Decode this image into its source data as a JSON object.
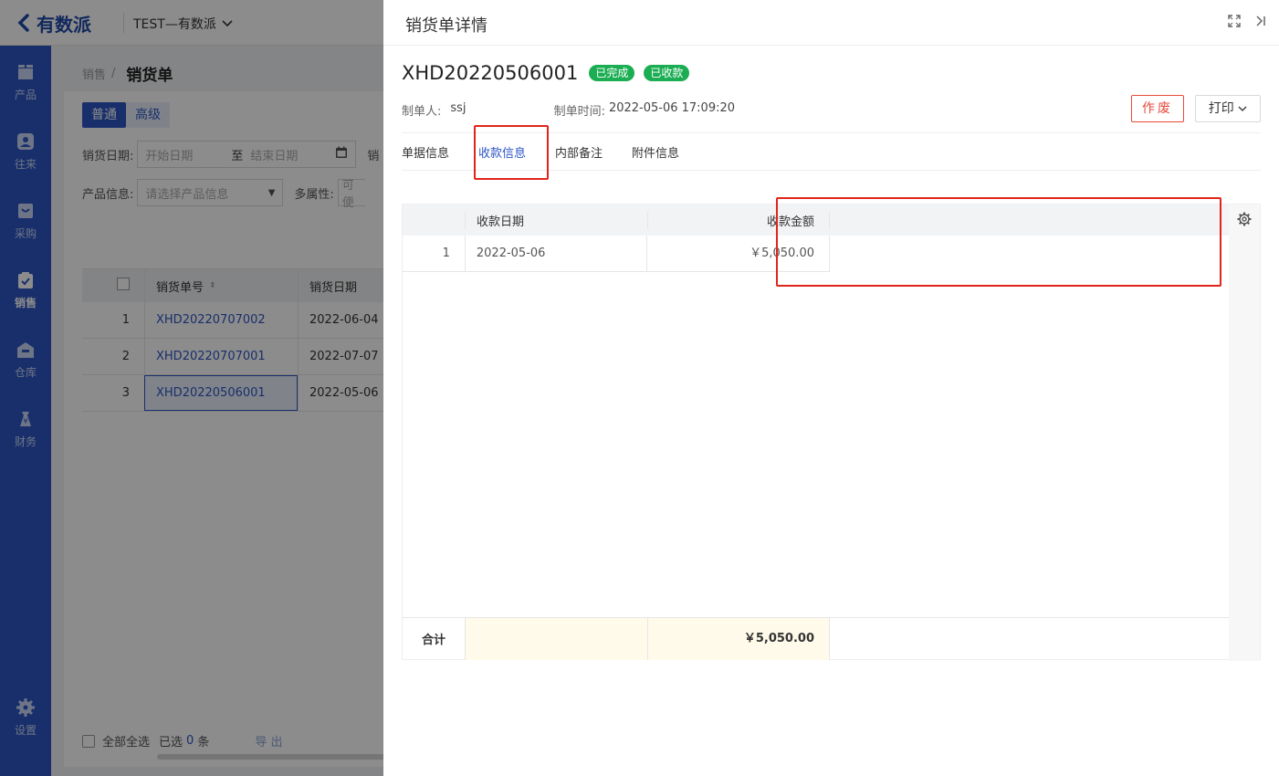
{
  "app": {
    "logo_text": "有数派",
    "company": "TEST—有数派"
  },
  "sidebar": {
    "items": [
      {
        "label": "产品",
        "icon": "box-icon"
      },
      {
        "label": "往来",
        "icon": "contact-icon"
      },
      {
        "label": "采购",
        "icon": "purchase-icon"
      },
      {
        "label": "销售",
        "icon": "sales-icon",
        "active": true
      },
      {
        "label": "仓库",
        "icon": "warehouse-icon"
      },
      {
        "label": "财务",
        "icon": "finance-icon"
      },
      {
        "label": "设置",
        "icon": "gear-icon"
      }
    ]
  },
  "list": {
    "breadcrumb_parent": "销售",
    "breadcrumb_sep": "/",
    "breadcrumb_current": "销货单",
    "mode_tabs": [
      "普通",
      "高级"
    ],
    "filters": {
      "date_label": "销货日期:",
      "start_placeholder": "开始日期",
      "to": "至",
      "end_placeholder": "结束日期",
      "cut_label": "销",
      "product_label": "产品信息:",
      "product_placeholder": "请选择产品信息",
      "attr_label": "多属性:",
      "attr_placeholder": "可便"
    },
    "columns": [
      "销货单号",
      "销货日期"
    ],
    "rows": [
      {
        "idx": "1",
        "no": "XHD20220707002",
        "date": "2022-06-04"
      },
      {
        "idx": "2",
        "no": "XHD20220707001",
        "date": "2022-07-07"
      },
      {
        "idx": "3",
        "no": "XHD20220506001",
        "date": "2022-05-06"
      }
    ],
    "footer": {
      "select_all": "全部全选",
      "selected_prefix": "已选",
      "selected_count": "0",
      "selected_suffix": "条",
      "export": "导 出"
    }
  },
  "drawer": {
    "title": "销货单详情",
    "doc_no": "XHD20220506001",
    "badges": [
      "已完成",
      "已收款"
    ],
    "creator_label": "制单人:",
    "creator": "ssj",
    "time_label": "制单时间:",
    "time": "2022-05-06 17:09:20",
    "void_btn": "作废",
    "print_btn": "打印",
    "tabs": [
      "单据信息",
      "收款信息",
      "内部备注",
      "附件信息"
    ],
    "active_tab": 1,
    "receipt": {
      "columns": [
        "收款日期",
        "收款金额"
      ],
      "rows": [
        {
          "idx": "1",
          "date": "2022-05-06",
          "amount": "￥5,050.00"
        }
      ],
      "total_label": "合计",
      "total_amount": "￥5,050.00"
    }
  },
  "colors": {
    "primary": "#2d56c4",
    "success": "#1aad52",
    "danger": "#e84a3c",
    "highlight": "#e1251b"
  }
}
